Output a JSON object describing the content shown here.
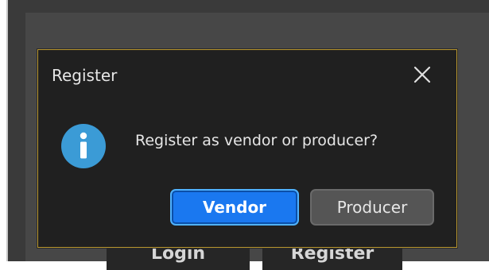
{
  "background": {
    "login_label": "Login",
    "register_label": "Register"
  },
  "dialog": {
    "title": "Register",
    "close_icon": "close-icon",
    "info_icon": "info-icon",
    "message": "Register as vendor or producer?",
    "buttons": {
      "vendor_label": "Vendor",
      "producer_label": "Producer"
    }
  },
  "colors": {
    "primary_button": "#1a78f0",
    "secondary_button": "#555555",
    "dialog_background": "#202020",
    "dialog_border": "#b8962e",
    "info_icon": "#3b9bd6"
  }
}
